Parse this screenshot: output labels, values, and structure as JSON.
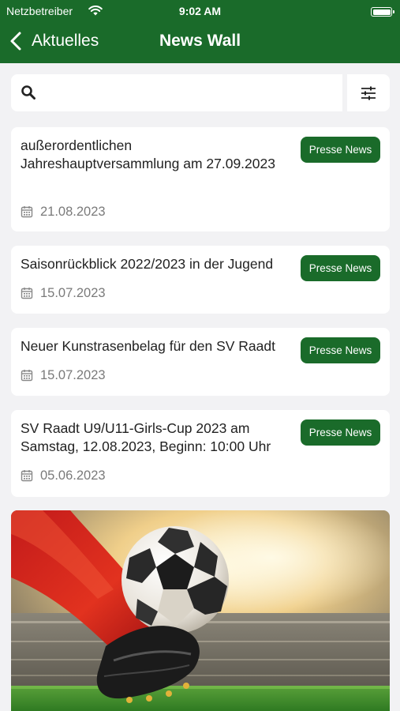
{
  "status": {
    "carrier": "Netzbetreiber",
    "time": "9:02 AM"
  },
  "nav": {
    "back_label": "Aktuelles",
    "title": "News Wall"
  },
  "search": {
    "value": "",
    "placeholder": ""
  },
  "news": [
    {
      "title": "außerordentlichen Jahreshauptversammlung am 27.09.2023",
      "badge": "Presse News",
      "date": "21.08.2023"
    },
    {
      "title": "Saisonrückblick 2022/2023 in der Jugend",
      "badge": "Presse News",
      "date": "15.07.2023"
    },
    {
      "title": "Neuer Kunstrasenbelag für den SV Raadt",
      "badge": "Presse News",
      "date": "15.07.2023"
    },
    {
      "title": "SV Raadt U9/U11-Girls-Cup 2023 am Samstag, 12.08.2023, Beginn: 10:00 Uhr",
      "badge": "Presse News",
      "date": "05.06.2023"
    }
  ],
  "colors": {
    "brand": "#1a6b2a",
    "background": "#f2f2f4",
    "date_text": "#7a7a7a"
  },
  "icons": [
    "wifi-icon",
    "battery-icon",
    "chevron-left-icon",
    "search-icon",
    "filter-sliders-icon",
    "calendar-icon"
  ]
}
